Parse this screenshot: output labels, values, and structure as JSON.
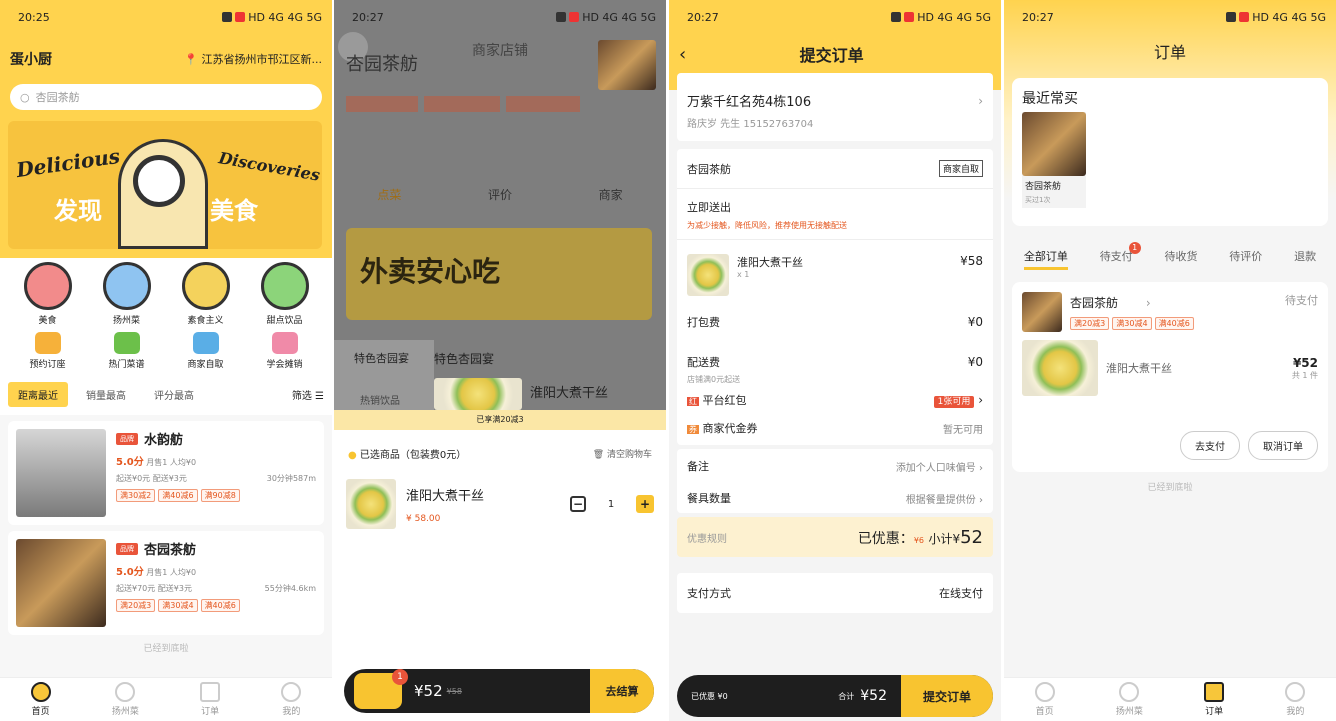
{
  "status": {
    "s1_time": "20:25",
    "s2_time": "20:27",
    "s3_time": "20:27",
    "s4_time": "20:27",
    "net": "HD 4G 4G 5G"
  },
  "s1": {
    "app_name": "蛋小厨",
    "location": "江苏省扬州市邗江区新...",
    "search_placeholder": "杏园茶舫",
    "banner_left": "Delicious",
    "banner_right": "Discoveries",
    "banner_title_left": "发现",
    "banner_title_right": "美食",
    "cats": [
      "美食",
      "扬州菜",
      "素食主义",
      "甜点饮品"
    ],
    "cats2": [
      "预约订座",
      "热门菜谱",
      "商家自取",
      "学会摊销"
    ],
    "sort": [
      "距离最近",
      "销量最高",
      "评分最高"
    ],
    "filter": "筛选",
    "shops": [
      {
        "badge": "品牌",
        "name": "水韵舫",
        "score": "5.0分",
        "sales": "月售1",
        "avg": "人均¥0",
        "fee": "起送¥0元  配送¥3元",
        "time": "30分钟",
        "dist": "587m",
        "tags": [
          "满30减2",
          "满40减6",
          "满90减8"
        ]
      },
      {
        "badge": "品牌",
        "name": "杏园茶舫",
        "score": "5.0分",
        "sales": "月售1",
        "avg": "人均¥0",
        "fee": "起送¥70元  配送¥3元",
        "time": "55分钟",
        "dist": "4.6km",
        "tags": [
          "满20减3",
          "满30减4",
          "满40减6"
        ]
      }
    ],
    "end_text": "已经到底啦",
    "nav": [
      "首页",
      "扬州菜",
      "订单",
      "我的"
    ]
  },
  "s2": {
    "title": "商家店铺",
    "shop": "杏园茶舫",
    "tabs": [
      "点菜",
      "评价",
      "商家"
    ],
    "promo": "外卖安心吃",
    "menu_cats": [
      "特色杏园宴",
      "特色杏园宴",
      "热销饮品"
    ],
    "dish_peek": "淮阳大煮干丝",
    "strip": "已享满20减3",
    "cart_title": "已选商品（包装费0元）",
    "clear": "清空购物车",
    "item": {
      "name": "淮阳大煮干丝",
      "price": "¥ 58.00",
      "qty": "1"
    },
    "count": "1",
    "total": "¥52",
    "orig": "¥58",
    "checkout": "去结算"
  },
  "s3": {
    "title": "提交订单",
    "addr": "万紫千红名苑4栋106",
    "contact": "路庆岁 先生  15152763704",
    "shop": "杏园茶舫",
    "pickup": "商家自取",
    "deliver": "立即送出",
    "note_hint": "为减少接触，降低风险，推荐使用无接触配送",
    "item": {
      "name": "淮阳大煮干丝",
      "qty": "x 1",
      "price": "¥58"
    },
    "pack_label": "打包费",
    "pack": "¥0",
    "ship_label": "配送费",
    "ship": "¥0",
    "ship_note": "店铺满0元起送",
    "red_label": "平台红包",
    "red_val": "1张可用",
    "coupon_label": "商家代金券",
    "coupon_val": "暂无可用",
    "remark_label": "备注",
    "remark_val": "添加个人口味偏号",
    "tableware_label": "餐具数量",
    "tableware_val": "根据餐量提供份",
    "rule": "优惠规则",
    "disc_label": "已优惠：",
    "disc": "¥6",
    "subtotal_label": "小计¥",
    "subtotal": "52",
    "pay_label": "支付方式",
    "pay_val": "在线支付",
    "bar_left": "已优惠 ¥0",
    "bar_total_label": "合计",
    "bar_total": "¥52",
    "submit": "提交订单"
  },
  "s4": {
    "title": "订单",
    "recent": "最近常买",
    "recent_shop": "杏园茶舫",
    "recent_times": "买过1次",
    "tabs": [
      "全部订单",
      "待支付",
      "待收货",
      "待评价",
      "退款"
    ],
    "badge": "1",
    "order": {
      "shop": "杏园茶舫",
      "status": "待支付",
      "tags": [
        "满20减3",
        "满30减4",
        "满40减6"
      ],
      "dish": "淮阳大煮干丝",
      "price": "¥52",
      "count": "共 1 件"
    },
    "pay_btn": "去支付",
    "cancel_btn": "取消订单",
    "end_text": "已经到底啦",
    "nav": [
      "首页",
      "扬州菜",
      "订单",
      "我的"
    ]
  },
  "colors": {
    "brand": "#ffd34e",
    "accent": "#f8c430",
    "red": "#e9543a"
  }
}
